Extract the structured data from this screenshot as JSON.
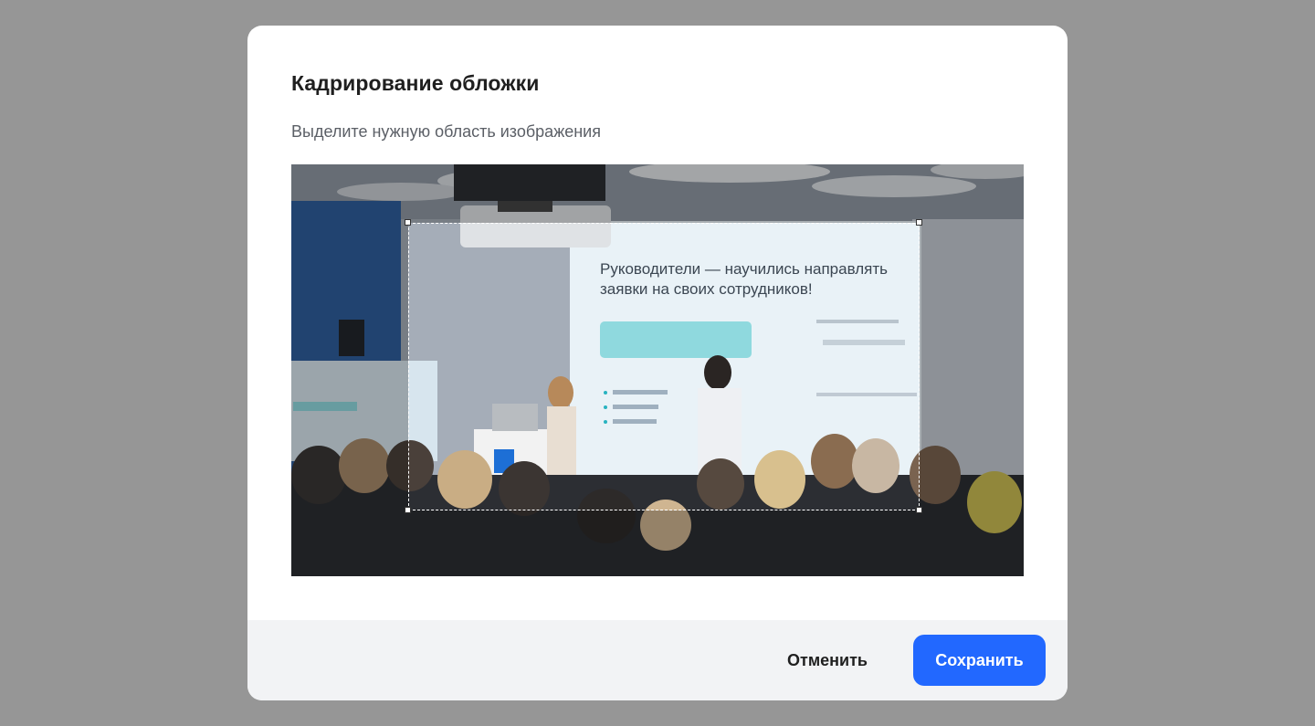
{
  "dialog": {
    "title": "Кадрирование обложки",
    "subtitle": "Выделите нужную область изображения"
  },
  "image": {
    "slide_heading_line1": "Руководители — научились направлять",
    "slide_heading_line2": "заявки на своих сотрудников!"
  },
  "footer": {
    "cancel_label": "Отменить",
    "save_label": "Сохранить"
  },
  "colors": {
    "overlay": "#969696",
    "primary": "#2268ff",
    "footer_bg": "#f2f3f5"
  }
}
